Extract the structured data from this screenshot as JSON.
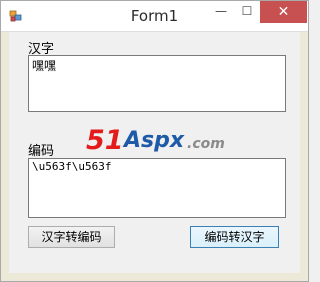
{
  "window": {
    "title": "Form1",
    "minimize_glyph": "—",
    "maximize_glyph": "☐",
    "close_glyph": "✕"
  },
  "source": {
    "label": "汉字",
    "value": "嘿嘿"
  },
  "encoded": {
    "label": "编码",
    "value": "\\u563f\\u563f"
  },
  "buttons": {
    "to_code": "汉字转编码",
    "to_chars": "编码转汉字"
  },
  "watermark": {
    "part1": "51",
    "part2": "Aspx",
    "part3": ".com"
  },
  "colors": {
    "close_button": "#c75050",
    "watermark_red": "#e31b1b",
    "watermark_blue": "#1e5aa8"
  },
  "icons": [
    "app-icon",
    "minimize-icon",
    "maximize-icon",
    "close-icon"
  ]
}
